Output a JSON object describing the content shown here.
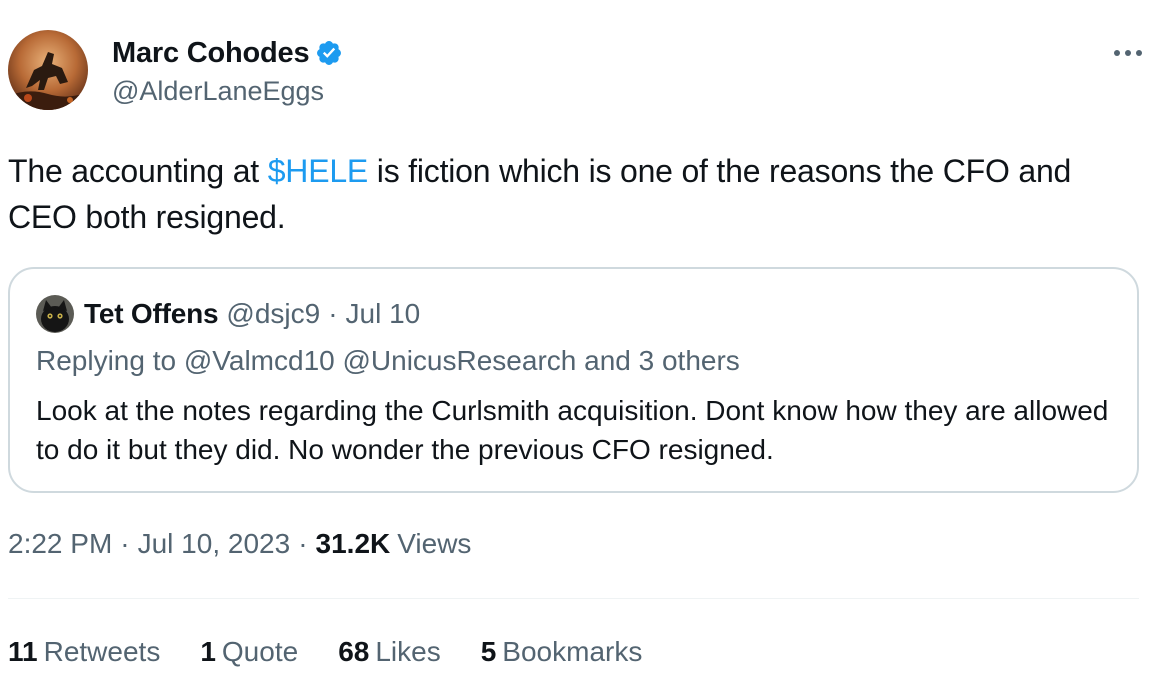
{
  "author": {
    "name": "Marc Cohodes",
    "handle": "@AlderLaneEggs",
    "verified": true
  },
  "tweet": {
    "text_before": "The accounting at ",
    "cashtag": "$HELE",
    "text_after": " is fiction which is one of the reasons the CFO and CEO both resigned."
  },
  "quoted_tweet": {
    "name": "Tet Offens",
    "handle": "@dsjc9",
    "dot": "·",
    "date": "Jul 10",
    "replying_to": "Replying to @Valmcd10 @UnicusResearch and 3 others",
    "text": "Look at the notes regarding the Curlsmith acquisition. Dont know how they are allowed to do it but they did. No wonder the previous CFO resigned."
  },
  "meta": {
    "time": "2:22 PM",
    "sep1": "·",
    "date": "Jul 10, 2023",
    "sep2": "·",
    "views_count": "31.2K",
    "views_label": "Views"
  },
  "stats": {
    "retweets_count": "11",
    "retweets_label": "Retweets",
    "quotes_count": "1",
    "quotes_label": "Quote",
    "likes_count": "68",
    "likes_label": "Likes",
    "bookmarks_count": "5",
    "bookmarks_label": "Bookmarks"
  },
  "colors": {
    "link": "#1d9bf0",
    "secondary_text": "#536471",
    "primary_text": "#0f1419",
    "border": "#cfd9de"
  },
  "icons": {
    "verified": "verified-badge-icon",
    "more": "more-horizontal-icon"
  }
}
